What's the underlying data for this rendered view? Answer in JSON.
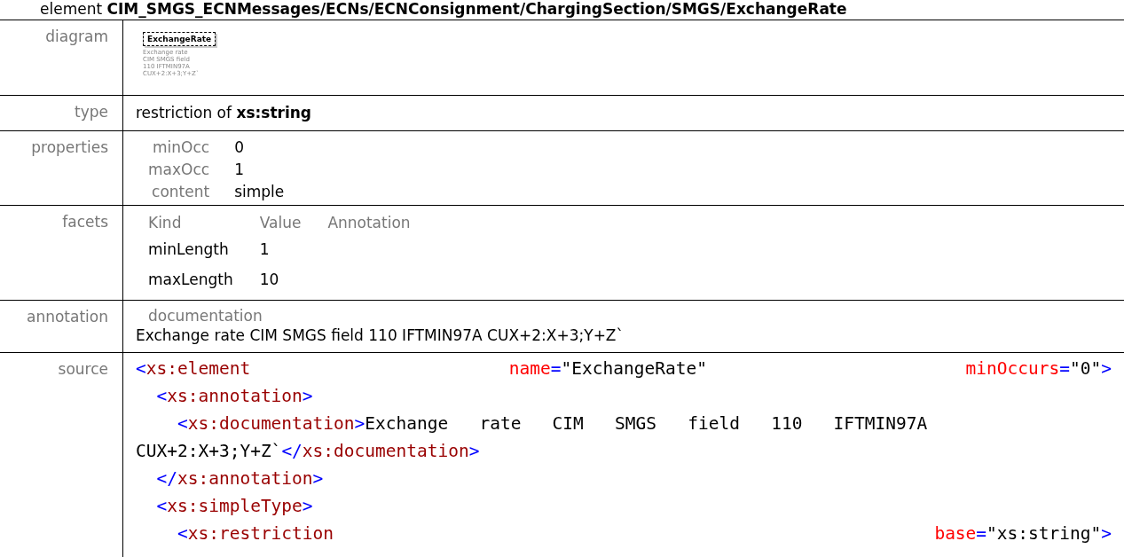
{
  "title": {
    "prefix": "element",
    "path": "CIM_SMGS_ECNMessages/ECNs/ECNConsignment/ChargingSection/SMGS/ExchangeRate"
  },
  "diagram": {
    "label": "diagram",
    "element_name": "ExchangeRate",
    "notes": [
      "Exchange rate",
      "CIM SMGS field",
      "110 IFTMIN97A",
      "CUX+2:X+3;Y+Z`"
    ]
  },
  "type": {
    "label": "type",
    "text": "restriction of **xs:string**"
  },
  "properties": {
    "label": "properties",
    "items": [
      {
        "name": "minOcc",
        "value": "0"
      },
      {
        "name": "maxOcc",
        "value": "1"
      },
      {
        "name": "content",
        "value": "simple"
      }
    ]
  },
  "facets": {
    "label": "facets",
    "columns": [
      "Kind",
      "Value",
      "Annotation"
    ],
    "rows": [
      {
        "kind": "minLength",
        "value": "1"
      },
      {
        "kind": "maxLength",
        "value": "10"
      }
    ]
  },
  "annotation": {
    "label": "annotation",
    "heading": "documentation",
    "text": "Exchange rate CIM SMGS field 110 IFTMIN97A CUX+2:X+3;Y+Z`"
  },
  "source": {
    "label": "source",
    "lines": [
      {
        "tokens": [
          {
            "kind": "bracket",
            "text": "<"
          },
          {
            "kind": "tag",
            "text": "xs:element"
          },
          {
            "kind": "attr",
            "text": "name"
          },
          {
            "kind": "bracket",
            "text": "="
          },
          {
            "kind": "text",
            "text": "\"ExchangeRate\""
          },
          {
            "kind": "attr",
            "text": "minOccurs"
          },
          {
            "kind": "bracket",
            "text": "="
          },
          {
            "kind": "text",
            "text": "\"0\""
          },
          {
            "kind": "bracket",
            "text": ">"
          }
        ],
        "children": [
          {
            "tokens": [
              {
                "kind": "bracket",
                "text": "<"
              },
              {
                "kind": "tag",
                "text": "xs:annotation"
              },
              {
                "kind": "bracket",
                "text": ">"
              }
            ],
            "children": [
              {
                "tokens": [
                  {
                    "kind": "bracket",
                    "text": "<"
                  },
                  {
                    "kind": "tag",
                    "text": "xs:documentation"
                  },
                  {
                    "kind": "bracket",
                    "text": ">"
                  },
                  {
                    "kind": "text",
                    "text": "Exchange   rate   CIM   SMGS   field   110   IFTMIN97A CUX+2:X+3;Y+Z`"
                  },
                  {
                    "kind": "bracket",
                    "text": "</"
                  },
                  {
                    "kind": "tag",
                    "text": "xs:documentation"
                  },
                  {
                    "kind": "bracket",
                    "text": ">"
                  }
                ]
              }
            ]
          },
          {
            "tokens": [
              {
                "kind": "bracket",
                "text": "</"
              },
              {
                "kind": "tag",
                "text": "xs:annotation"
              },
              {
                "kind": "bracket",
                "text": ">"
              }
            ]
          },
          {
            "tokens": [
              {
                "kind": "bracket",
                "text": "<"
              },
              {
                "kind": "tag",
                "text": "xs:simpleType"
              },
              {
                "kind": "bracket",
                "text": ">"
              }
            ],
            "children": [
              {
                "tokens": [
                  {
                    "kind": "bracket",
                    "text": "<"
                  },
                  {
                    "kind": "tag",
                    "text": "xs:restriction"
                  },
                  {
                    "kind": "attr",
                    "text": "base"
                  },
                  {
                    "kind": "bracket",
                    "text": "="
                  },
                  {
                    "kind": "text",
                    "text": "\"xs:string\""
                  },
                  {
                    "kind": "bracket",
                    "text": ">"
                  }
                ]
              }
            ]
          }
        ]
      }
    ]
  }
}
